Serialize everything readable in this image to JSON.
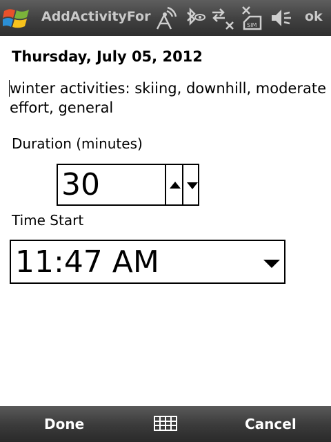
{
  "titlebar": {
    "title": "AddActivityFor",
    "ok_label": "ok",
    "icons": [
      "windows-start-icon",
      "network-icon",
      "bluetooth-icon",
      "data-connection-icon",
      "no-sim-icon",
      "volume-off-icon"
    ]
  },
  "content": {
    "date_heading": "Thursday, July 05, 2012",
    "activity_description": "winter activities: skiing, downhill, moderate effort, general",
    "duration": {
      "label": "Duration (minutes)",
      "value": "30"
    },
    "time_start": {
      "label": "Time Start",
      "value": "11:47 AM"
    }
  },
  "softkeys": {
    "left_label": "Done",
    "right_label": "Cancel",
    "center_icon": "keyboard-icon"
  },
  "colors": {
    "bar_dark": "#2f2f2f",
    "bar_light": "#5e5e5e",
    "title_text": "#c9c9c9",
    "softkey_text": "#ffffff"
  }
}
